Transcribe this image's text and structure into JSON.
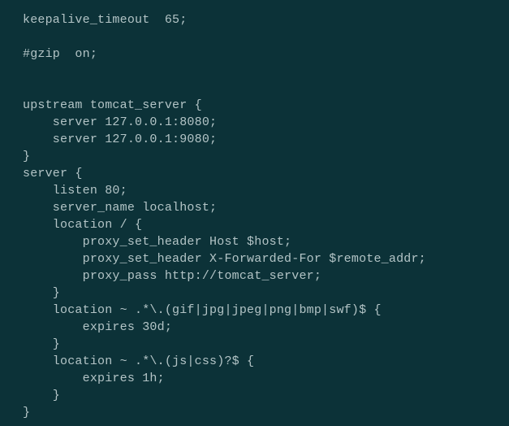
{
  "code": {
    "lines": [
      "keepalive_timeout  65;",
      "",
      "#gzip  on;",
      "",
      "",
      "upstream tomcat_server {",
      "    server 127.0.0.1:8080;",
      "    server 127.0.0.1:9080;",
      "}",
      "server {",
      "    listen 80;",
      "    server_name localhost;",
      "    location / {",
      "        proxy_set_header Host $host;",
      "        proxy_set_header X-Forwarded-For $remote_addr;",
      "        proxy_pass http://tomcat_server;",
      "    }",
      "    location ~ .*\\.(gif|jpg|jpeg|png|bmp|swf)$ {",
      "        expires 30d;",
      "    }",
      "    location ~ .*\\.(js|css)?$ {",
      "        expires 1h;",
      "    }",
      "}"
    ]
  }
}
